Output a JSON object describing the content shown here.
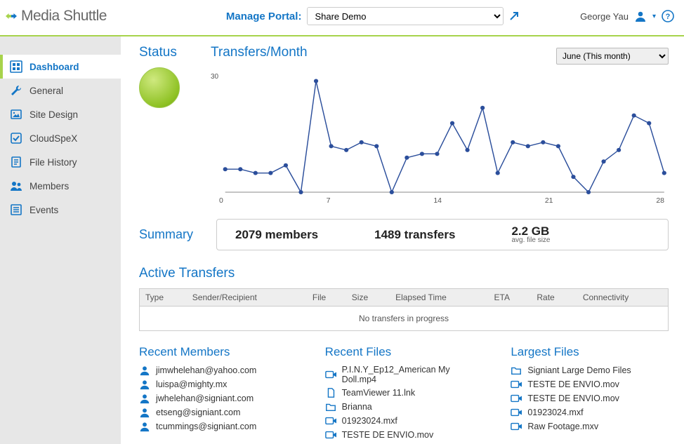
{
  "brand": {
    "name": "Media Shuttle"
  },
  "topbar": {
    "manage_label": "Manage Portal:",
    "portal_selected": "Share Demo",
    "user_name": "George Yau"
  },
  "sidebar": {
    "items": [
      {
        "icon": "dashboard-icon",
        "label": "Dashboard",
        "active": true
      },
      {
        "icon": "wrench-icon",
        "label": "General"
      },
      {
        "icon": "palette-icon",
        "label": "Site Design"
      },
      {
        "icon": "check-icon",
        "label": "CloudSpeX"
      },
      {
        "icon": "history-icon",
        "label": "File History"
      },
      {
        "icon": "people-icon",
        "label": "Members"
      },
      {
        "icon": "list-icon",
        "label": "Events"
      }
    ]
  },
  "status": {
    "title": "Status",
    "state": "ok"
  },
  "chart_data": {
    "type": "line",
    "title": "Transfers/Month",
    "period_selected": "June (This month)",
    "xlabel": "",
    "ylabel": "",
    "ylim": [
      0,
      30
    ],
    "x_ticks": [
      "0",
      "7",
      "14",
      "21",
      "28"
    ],
    "x": [
      1,
      2,
      3,
      4,
      5,
      6,
      7,
      8,
      9,
      10,
      11,
      12,
      13,
      14,
      15,
      16,
      17,
      18,
      19,
      20,
      21,
      22,
      23,
      24,
      25,
      26,
      27,
      28,
      29,
      30
    ],
    "values": [
      6,
      6,
      5,
      5,
      7,
      0,
      29,
      12,
      11,
      13,
      12,
      0,
      9,
      10,
      10,
      18,
      11,
      22,
      5,
      13,
      12,
      13,
      12,
      4,
      0,
      8,
      11,
      20,
      18,
      5
    ]
  },
  "summary": {
    "title": "Summary",
    "members": "2079 members",
    "transfers": "1489 transfers",
    "avg_size": "2.2 GB",
    "avg_label": "avg. file size"
  },
  "active_transfers": {
    "title": "Active Transfers",
    "columns": [
      "Type",
      "Sender/Recipient",
      "File",
      "Size",
      "Elapsed Time",
      "ETA",
      "Rate",
      "Connectivity"
    ],
    "empty": "No transfers in progress"
  },
  "recent_members": {
    "title": "Recent Members",
    "items": [
      "jimwhelehan@yahoo.com",
      "luispa@mighty.mx",
      "jwhelehan@signiant.com",
      "etseng@signiant.com",
      "tcummings@signiant.com"
    ]
  },
  "recent_files": {
    "title": "Recent Files",
    "items": [
      {
        "icon": "video-icon",
        "name": "P.I.N.Y_Ep12_American My Doll.mp4"
      },
      {
        "icon": "file-icon",
        "name": "TeamViewer 11.lnk"
      },
      {
        "icon": "folder-icon",
        "name": "Brianna"
      },
      {
        "icon": "video-icon",
        "name": "01923024.mxf"
      },
      {
        "icon": "video-icon",
        "name": "TESTE DE ENVIO.mov"
      }
    ]
  },
  "largest_files": {
    "title": "Largest Files",
    "items": [
      {
        "icon": "folder-icon",
        "name": "Signiant Large Demo Files"
      },
      {
        "icon": "video-icon",
        "name": "TESTE DE ENVIO.mov"
      },
      {
        "icon": "video-icon",
        "name": "TESTE DE ENVIO.mov"
      },
      {
        "icon": "video-icon",
        "name": "01923024.mxf"
      },
      {
        "icon": "video-icon",
        "name": "Raw Footage.mxv"
      }
    ]
  },
  "colors": {
    "accent": "#1476c6",
    "lime": "#a7d34b"
  }
}
